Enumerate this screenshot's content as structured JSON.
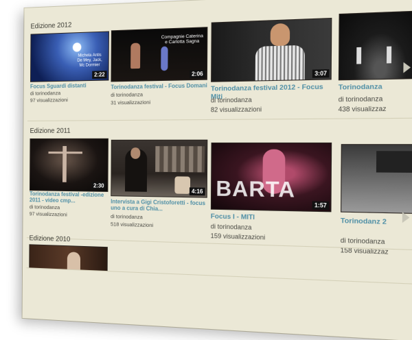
{
  "sections": [
    {
      "title": "Edizione 2012",
      "videos": [
        {
          "title": "Focus Sguardi distanti",
          "author": "di torinodanza",
          "views": "97 visualizzazioni",
          "duration": "2:22",
          "overlay": "Michela Antis De Mey, Jack, Mc Dormier"
        },
        {
          "title": "Torinodanza festival - Focus Domani",
          "author": "di torinodanza",
          "views": "31 visualizzazioni",
          "duration": "2:06",
          "overlay": "Compagnie Caterina e Carlotta Sagna"
        },
        {
          "title": "Torinodanza festival 2012 - Focus Miti",
          "author": "di torinodanza",
          "views": "82 visualizzazioni",
          "duration": "3:07"
        },
        {
          "title": "Torinodanza",
          "author": "di torinodanza",
          "views": "438 visualizzaz"
        }
      ]
    },
    {
      "title": "Edizione 2011",
      "videos": [
        {
          "title": "Torinodanza festival -edizione 2011 - video cmp...",
          "author": "di torinodanza",
          "views": "97 visualizzazioni",
          "duration": "2:30"
        },
        {
          "title": "Intervista a Gigi Cristoforetti - focus uno a cura di Chia...",
          "author": "di torinodanza",
          "views": "518 visualizzazioni",
          "duration": "4:16"
        },
        {
          "title": "Focus I - MITI",
          "author": "di torinodanza",
          "views": "159 visualizzazioni",
          "duration": "1:57",
          "overlay": "BARTA"
        },
        {
          "title": "Torinodanz 2",
          "author": "di torinodanza",
          "views": "158 visualizzaz"
        }
      ]
    },
    {
      "title": "Edizione 2010",
      "videos": []
    }
  ],
  "icons": {
    "next": "chevron-right-icon"
  }
}
